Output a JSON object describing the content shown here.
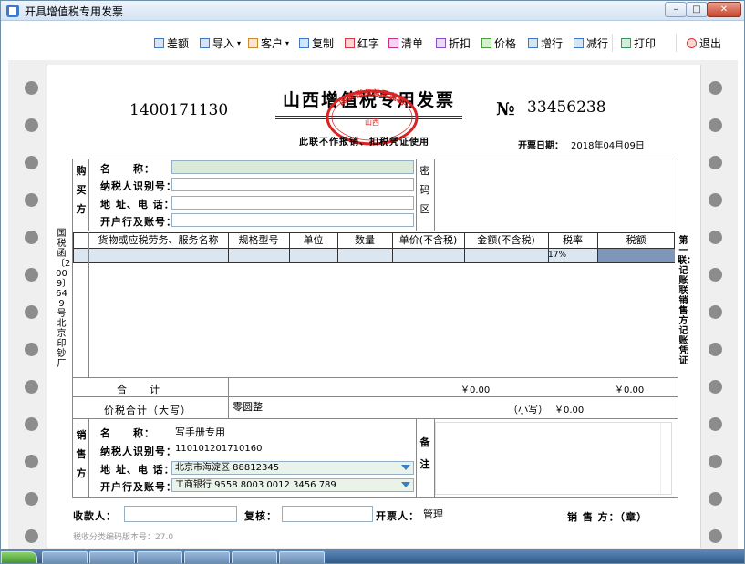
{
  "window": {
    "title": "开具增值税专用发票",
    "min_glyph": "–",
    "max_glyph": "□",
    "close_glyph": "✕"
  },
  "toolbar": {
    "items": [
      {
        "key": "diff",
        "label": "差额",
        "icon": "invoice-icon",
        "color": "#3c7ac8"
      },
      {
        "key": "import",
        "label": "导入",
        "icon": "import-icon",
        "color": "#3c7ac8",
        "arrow": "▾"
      },
      {
        "key": "customer",
        "label": "客户",
        "icon": "customer-icon",
        "color": "#cc8833",
        "arrow": "▾"
      },
      {
        "key": "copy",
        "label": "复制",
        "icon": "copy-icon",
        "color": "#3c7ac8"
      },
      {
        "key": "redword",
        "label": "红字",
        "icon": "red-invoice-icon",
        "color": "#d23b3b"
      },
      {
        "key": "list",
        "label": "清单",
        "icon": "list-icon",
        "color": "#c2338f"
      },
      {
        "key": "discount",
        "label": "折扣",
        "icon": "discount-icon",
        "color": "#8a4fc4"
      },
      {
        "key": "price",
        "label": "价格",
        "icon": "price-icon",
        "color": "#4e9a3a"
      },
      {
        "key": "addrow",
        "label": "增行",
        "icon": "add-row-icon",
        "color": "#3c7ac8"
      },
      {
        "key": "delrow",
        "label": "减行",
        "icon": "delete-row-icon",
        "color": "#3c7ac8"
      },
      {
        "key": "print",
        "label": "打印",
        "icon": "print-icon",
        "color": "#2f9a5a"
      },
      {
        "key": "exit",
        "label": "退出",
        "icon": "power-icon",
        "color": "#d23b3b"
      }
    ]
  },
  "invoice": {
    "code": "1400171130",
    "title": "山西增值税专用发票",
    "subtitle": "此联不作报销、扣税凭证使用",
    "no_label": "№",
    "number": "33456238",
    "date_label": "开票日期：",
    "date": "2018年04月09日",
    "seal_text": "国家税务总局监制",
    "seal_region": "山西"
  },
  "buyer": {
    "side": "购买方",
    "name_label": "名　　称：",
    "name": "",
    "taxid_label": "纳税人识别号：",
    "taxid": "",
    "addr_label": "地 址、电 话：",
    "addr": "",
    "bank_label": "开户行及账号：",
    "bank": "",
    "secret": "密码区"
  },
  "items": {
    "headers": [
      "货物或应税劳务、服务名称",
      "规格型号",
      "单位",
      "数量",
      "单价(不含税)",
      "金额(不含税)",
      "税率",
      "税额"
    ],
    "rows": [
      {
        "rate": "17%"
      }
    ]
  },
  "totals": {
    "label": "合　　计",
    "amount": "￥0.00",
    "tax": "￥0.00"
  },
  "price_tax": {
    "label": "价税合计（大写）",
    "upper": "零圆整",
    "lower_label": "（小写）",
    "lower": "￥0.00"
  },
  "seller": {
    "side": "销售方",
    "name_label": "名　　称：",
    "name": "写手册专用",
    "taxid_label": "纳税人识别号：",
    "taxid": "110101201710160",
    "addr_label": "地 址、电 话：",
    "addr": "北京市海淀区 88812345",
    "bank_label": "开户行及账号：",
    "bank": "工商银行 9558 8003 0012 3456 789",
    "remark": "备注"
  },
  "footer": {
    "payee_label": "收款人：",
    "payee": "",
    "review_label": "复核：",
    "review": "",
    "issuer_label": "开票人：",
    "issuer": "管理",
    "seller_seal": "销 售 方：（章）",
    "version": "税收分类编码版本号：27.0"
  },
  "side_text": {
    "left": "国税函〔2009〕649号北京印钞厂",
    "right": "第一联：记账联　销售方记账凭证"
  }
}
